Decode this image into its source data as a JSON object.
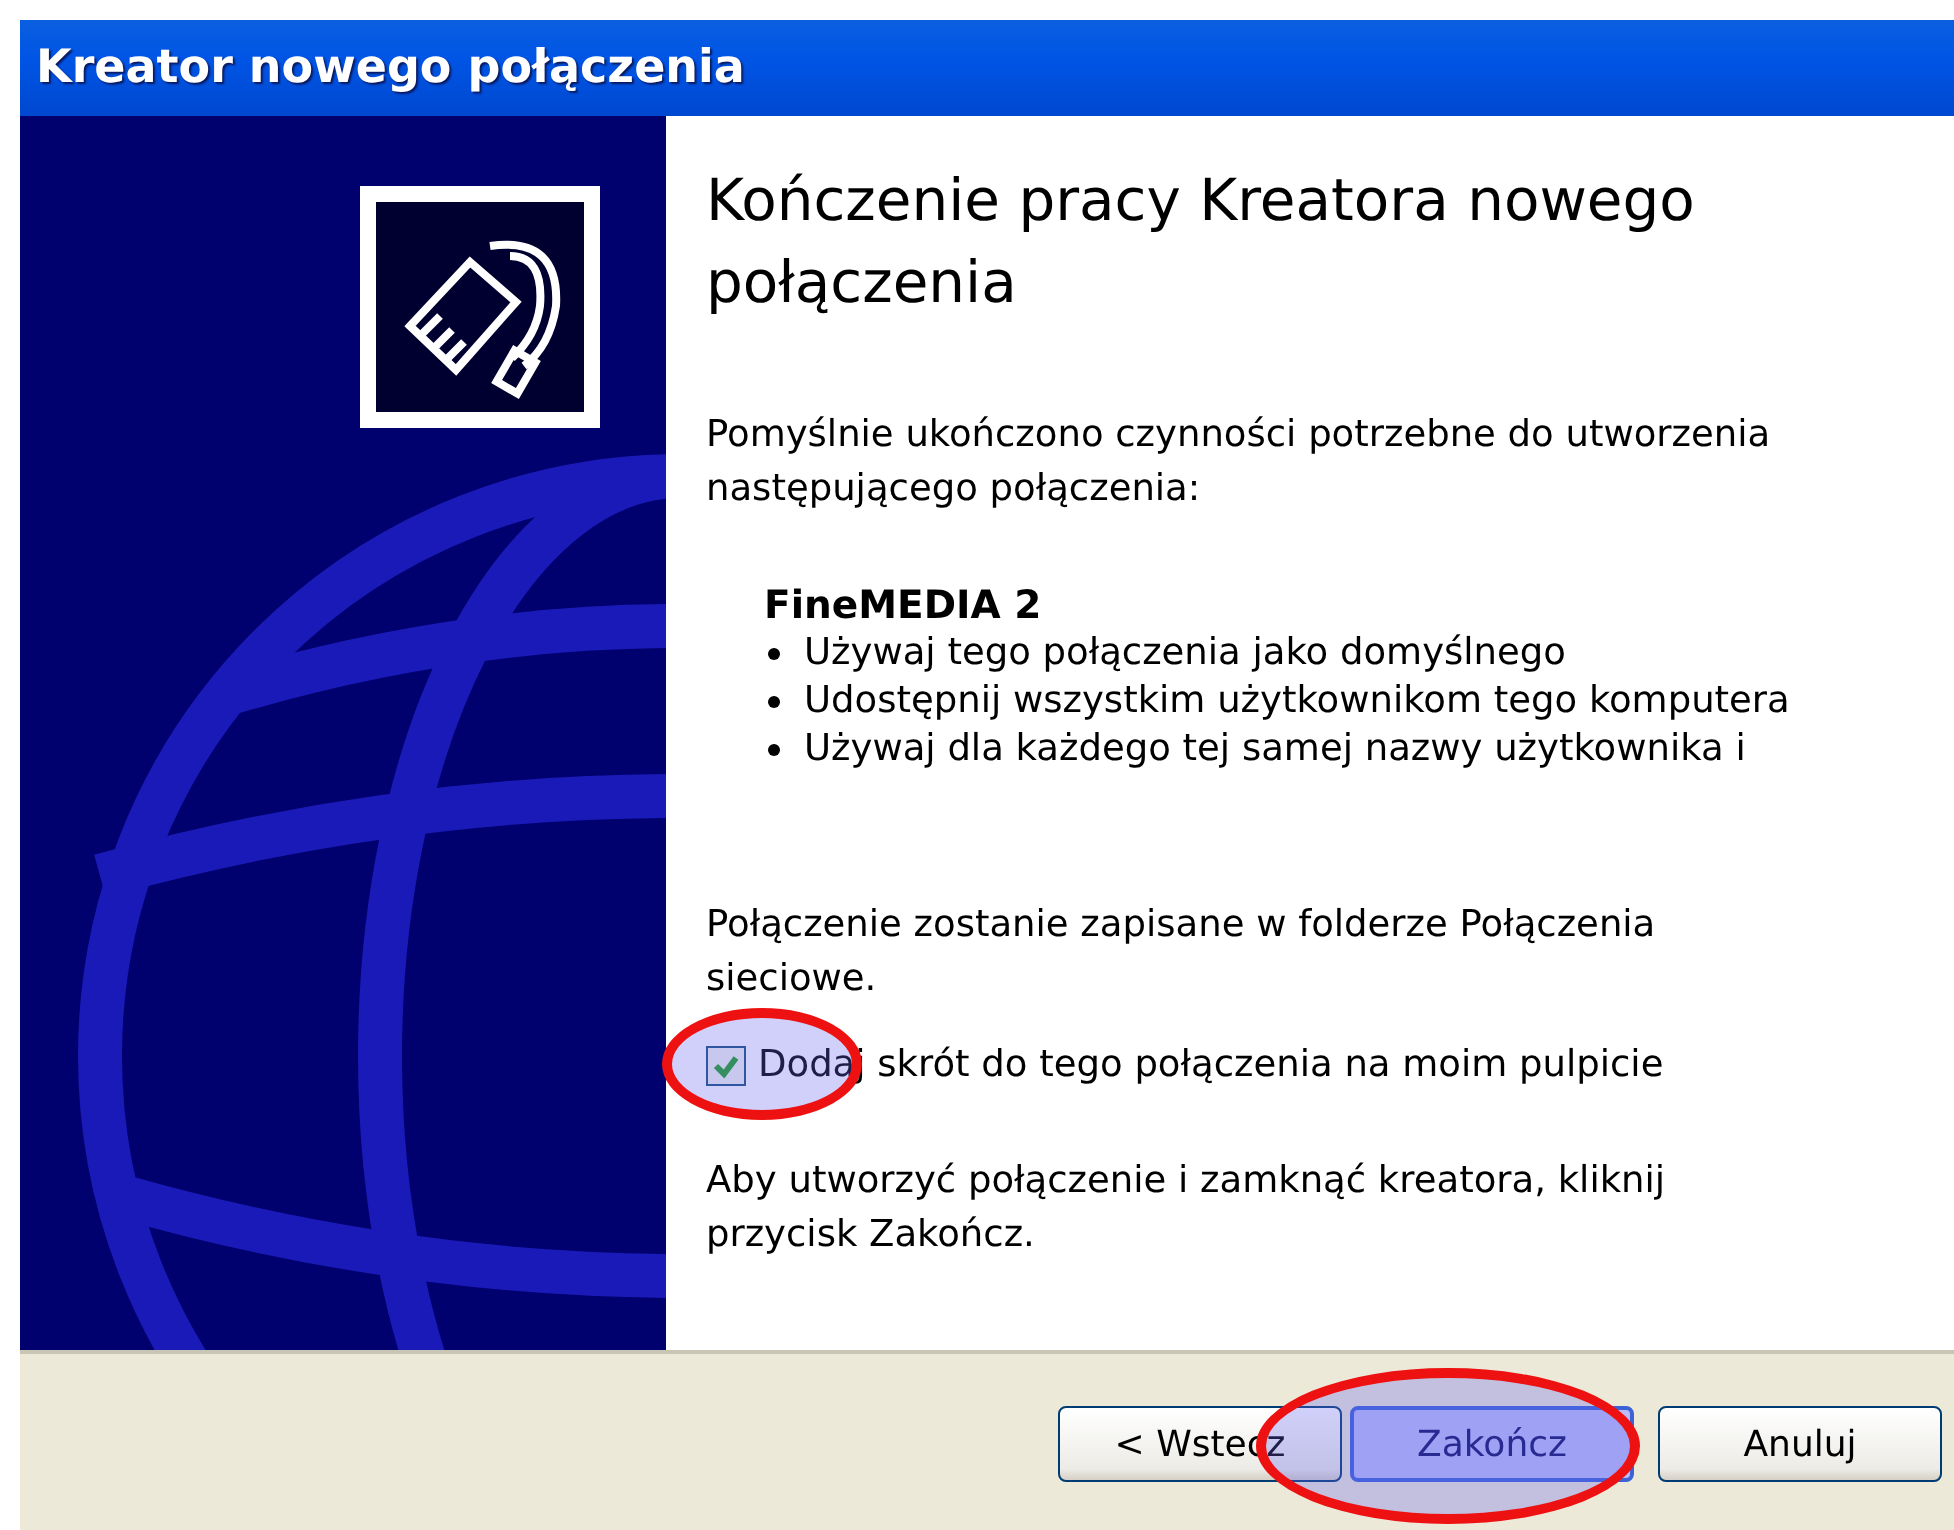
{
  "window": {
    "title": "Kreator nowego połączenia"
  },
  "heading": "Kończenie pracy Kreatora nowego połączenia",
  "intro": "Pomyślnie ukończono czynności potrzebne do utworzenia następującego połączenia:",
  "connection_name": "FineMEDIA 2",
  "bullets": [
    "Używaj tego połączenia jako domyślnego",
    "Udostępnij wszystkim użytkownikom tego komputera",
    "Używaj dla każdego tej samej nazwy użytkownika i"
  ],
  "note": "Połączenie zostanie zapisane w folderze Połączenia sieciowe.",
  "checkbox": {
    "label": "Dodaj skrót do tego połączenia na moim pulpicie",
    "checked": true
  },
  "instruction": "Aby utworzyć połączenie i zamknąć kreatora, kliknij przycisk Zakończ.",
  "buttons": [
    {
      "label": "< Wstecz",
      "kind": "normal"
    },
    {
      "label": "Zakończ",
      "kind": "default"
    },
    {
      "label": "Anuluj",
      "kind": "normal"
    }
  ]
}
